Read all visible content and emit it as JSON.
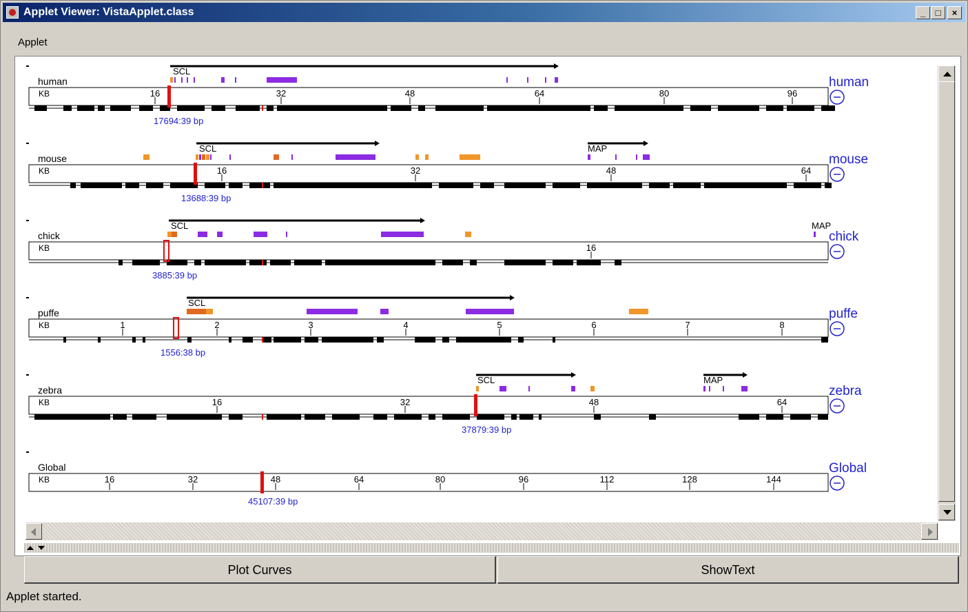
{
  "window": {
    "title": "Applet Viewer: VistaApplet.class",
    "title_icon": "java-coffee-icon",
    "controls": {
      "minimize": "_",
      "maximize": "□",
      "close": "×"
    }
  },
  "menu": {
    "items": [
      "Applet"
    ]
  },
  "colors": {
    "accent_label": "#2222cc",
    "cursor": "#e01010",
    "gene": "#000000",
    "feature_purple": "#8b2be2",
    "feature_orange": "#f0962a",
    "feature_darkorange": "#e06a20"
  },
  "tracks": [
    {
      "name": "human",
      "label": "human",
      "unit": "KB",
      "tick_labels": [
        "16",
        "32",
        "48",
        "64",
        "80",
        "96"
      ],
      "position_label": "17694:39 bp",
      "gene_labels": [
        "SCL"
      ]
    },
    {
      "name": "mouse",
      "label": "mouse",
      "unit": "KB",
      "tick_labels": [
        "16",
        "32",
        "48",
        "64"
      ],
      "position_label": "13688:39 bp",
      "gene_labels": [
        "SCL",
        "MAP"
      ]
    },
    {
      "name": "chick",
      "label": "chick",
      "unit": "KB",
      "tick_labels": [
        "16"
      ],
      "position_label": "3885:39 bp",
      "gene_labels": [
        "SCL",
        "MAP"
      ]
    },
    {
      "name": "puffe",
      "label": "puffe",
      "unit": "KB",
      "tick_labels": [
        "1",
        "2",
        "3",
        "4",
        "5",
        "6",
        "7",
        "8"
      ],
      "position_label": "1556:38 bp",
      "gene_labels": [
        "SCL"
      ]
    },
    {
      "name": "zebra",
      "label": "zebra",
      "unit": "KB",
      "tick_labels": [
        "16",
        "32",
        "48",
        "64"
      ],
      "position_label": "37879:39 bp",
      "gene_labels": [
        "SCL",
        "MAP"
      ]
    },
    {
      "name": "Global",
      "label": "Global",
      "unit": "KB",
      "tick_labels": [
        "16",
        "32",
        "48",
        "64",
        "80",
        "96",
        "112",
        "128",
        "144"
      ],
      "position_label": "45107:39 bp",
      "gene_labels": []
    }
  ],
  "buttons": {
    "plot_curves": "Plot Curves",
    "show_text": "ShowText"
  },
  "status": "Applet started."
}
